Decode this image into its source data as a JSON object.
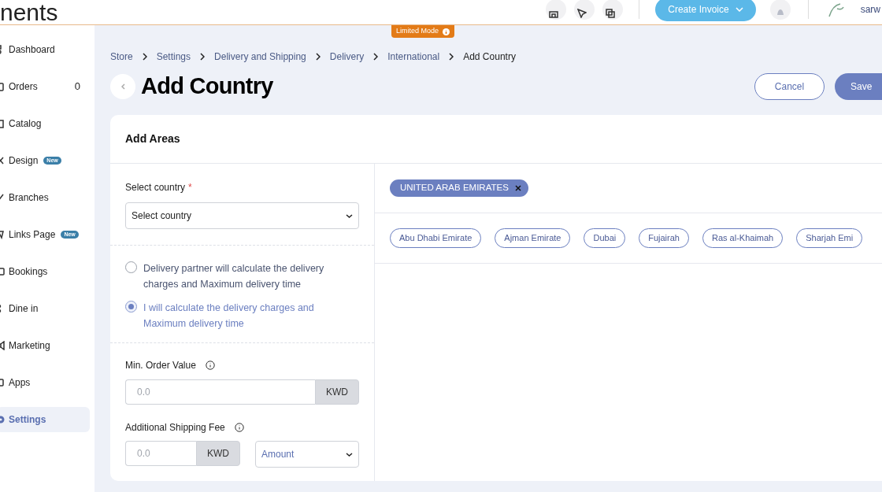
{
  "header": {
    "logo_text": "nents",
    "create_invoice": "Create Invoice",
    "user_name": "sarw"
  },
  "limited_mode": "Limited Mode",
  "sidebar": {
    "items": [
      {
        "label": "Dashboard",
        "selected": false
      },
      {
        "label": "Orders",
        "count": "0",
        "selected": false
      },
      {
        "label": "Catalog",
        "selected": false
      },
      {
        "label": "Design",
        "badge": "New",
        "selected": false
      },
      {
        "label": "Branches",
        "selected": false
      },
      {
        "label": "Links Page",
        "badge": "New",
        "selected": false
      },
      {
        "label": "Bookings",
        "selected": false
      },
      {
        "label": "Dine in",
        "selected": false
      },
      {
        "label": "Marketing",
        "selected": false
      },
      {
        "label": "Apps",
        "selected": false
      },
      {
        "label": "Settings",
        "selected": true
      }
    ]
  },
  "breadcrumb": [
    "Store",
    "Settings",
    "Delivery and Shipping",
    "Delivery",
    "International",
    "Add Country"
  ],
  "title": "Add Country",
  "buttons": {
    "cancel": "Cancel",
    "save": "Save"
  },
  "card": {
    "title": "Add Areas",
    "country": {
      "label": "Select country",
      "required": "*",
      "value": "Select country"
    },
    "delivery_options": [
      {
        "label": "Delivery partner will calculate the delivery charges and Maximum delivery time",
        "selected": false
      },
      {
        "label": "I will calculate the delivery charges and Maximum delivery time",
        "selected": true
      }
    ],
    "min_order": {
      "label": "Min. Order Value",
      "placeholder": "0.0",
      "unit": "KWD"
    },
    "shipping_fee": {
      "label": "Additional Shipping Fee",
      "placeholder": "0.0",
      "unit": "KWD",
      "type": "Amount"
    },
    "selected_country": "UNITED ARAB EMIRATES",
    "areas": [
      "Abu Dhabi Emirate",
      "Ajman Emirate",
      "Dubai",
      "Fujairah",
      "Ras al-Khaimah",
      "Sharjah Emi"
    ]
  }
}
